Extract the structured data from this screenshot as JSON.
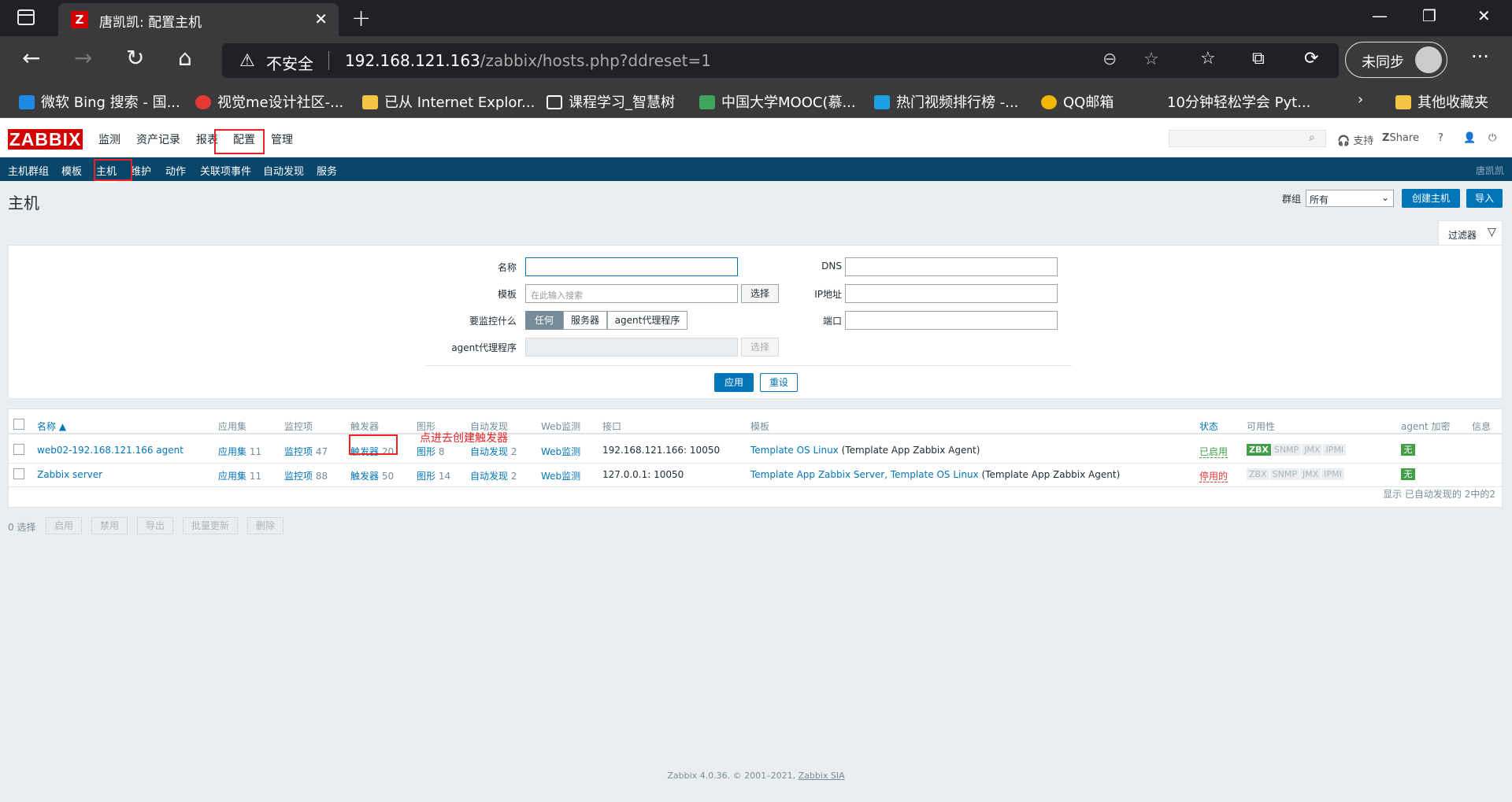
{
  "browser": {
    "tab_title": "唐凯凯: 配置主机",
    "tab_favicon": "Z",
    "insecure_label": "不安全",
    "url_host": "192.168.121.163",
    "url_path": "/zabbix/hosts.php?ddreset=1",
    "sync_label": "未同步",
    "bookmarks": [
      "微软 Bing 搜索 - 国...",
      "视觉me设计社区-...",
      "已从 Internet Explor...",
      "课程学习_智慧树",
      "中国大学MOOC(慕...",
      "热门视频排行榜 -...",
      "QQ邮箱",
      "10分钟轻松学会 Pyt...",
      "其他收藏夹"
    ]
  },
  "zabbix": {
    "logo": "ZABBIX",
    "main_menu": [
      "监测",
      "资产记录",
      "报表",
      "配置",
      "管理"
    ],
    "header_links": {
      "support": "支持",
      "share": "Share",
      "help": "?"
    },
    "sub_menu": [
      "主机群组",
      "模板",
      "主机",
      "维护",
      "动作",
      "关联项事件",
      "自动发现",
      "服务"
    ],
    "user": "唐凯凯",
    "page_title": "主机",
    "group_label": "群组",
    "group_value": "所有",
    "create_host": "创建主机",
    "import": "导入",
    "filter_label": "过滤器",
    "filter": {
      "name_label": "名称",
      "template_label": "模板",
      "template_placeholder": "在此输入搜索",
      "select": "选择",
      "monitored_by_label": "要监控什么",
      "monitored_by_options": [
        "任何",
        "服务器",
        "agent代理程序"
      ],
      "proxy_label": "agent代理程序",
      "dns_label": "DNS",
      "ip_label": "IP地址",
      "port_label": "端口",
      "apply": "应用",
      "reset": "重设"
    },
    "table": {
      "headers": [
        "名称 ▲",
        "应用集",
        "监控项",
        "触发器",
        "图形",
        "自动发现",
        "Web监测",
        "接口",
        "模板",
        "状态",
        "可用性",
        "agent 加密",
        "信息"
      ],
      "rows": [
        {
          "name": "web02-192.168.121.166 agent",
          "apps": "应用集",
          "apps_count": "11",
          "items": "监控项",
          "items_count": "47",
          "triggers": "触发器",
          "triggers_count": "20",
          "graphs": "图形",
          "graphs_count": "8",
          "discovery": "自动发现",
          "discovery_count": "2",
          "web": "Web监测",
          "interface": "192.168.121.166: 10050",
          "template_a": "Template OS Linux",
          "template_b": "(Template App Zabbix Agent)",
          "status": "已启用",
          "encryption": "无"
        },
        {
          "name": "Zabbix server",
          "apps": "应用集",
          "apps_count": "11",
          "items": "监控项",
          "items_count": "88",
          "triggers": "触发器",
          "triggers_count": "50",
          "graphs": "图形",
          "graphs_count": "14",
          "discovery": "自动发现",
          "discovery_count": "2",
          "web": "Web监测",
          "interface": "127.0.0.1: 10050",
          "template_a": "Template App Zabbix Server, Template OS Linux",
          "template_b": "(Template App Zabbix Agent)",
          "status": "停用的",
          "encryption": "无"
        }
      ],
      "availability": [
        "ZBX",
        "SNMP",
        "JMX",
        "IPMI"
      ],
      "footer": "显示 已自动发现的 2中的2"
    },
    "annotation": "点进去创建触发器",
    "bulk": {
      "selected": "0 选择",
      "buttons": [
        "启用",
        "禁用",
        "导出",
        "批量更新",
        "删除"
      ]
    },
    "footer": {
      "text": "Zabbix 4.0.36. © 2001–2021,",
      "company": "Zabbix SIA"
    }
  }
}
